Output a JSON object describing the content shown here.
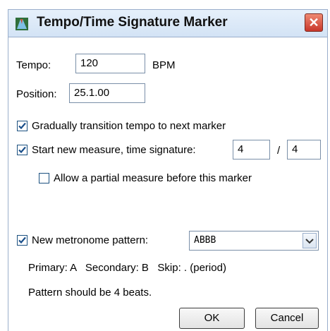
{
  "window": {
    "title": "Tempo/Time Signature Marker",
    "close_glyph": "✕"
  },
  "tempo": {
    "label": "Tempo:",
    "value": "120",
    "unit": "BPM"
  },
  "position": {
    "label": "Position:",
    "value": "25.1.00"
  },
  "options": {
    "gradual_transition": {
      "label": "Gradually transition tempo to next marker",
      "checked": true
    },
    "new_measure": {
      "label": "Start new measure, time signature:",
      "checked": true,
      "numerator": "4",
      "separator": "/",
      "denominator": "4"
    },
    "partial_measure": {
      "label": "Allow a partial measure before this marker",
      "checked": false
    }
  },
  "metronome": {
    "label": "New metronome pattern:",
    "checked": true,
    "pattern": "ABBB"
  },
  "info": {
    "legend": "Primary: A   Secondary: B   Skip: . (period)",
    "beats_note": "Pattern should be 4 beats."
  },
  "buttons": {
    "ok": "OK",
    "cancel": "Cancel"
  },
  "colors": {
    "check": "#1a4f8a",
    "title_bar": "#d3e3f5",
    "close_button": "#c8362a"
  },
  "icons": {
    "app": "reaper-app-icon",
    "close": "close-icon",
    "dropdown": "chevron-down-icon"
  }
}
